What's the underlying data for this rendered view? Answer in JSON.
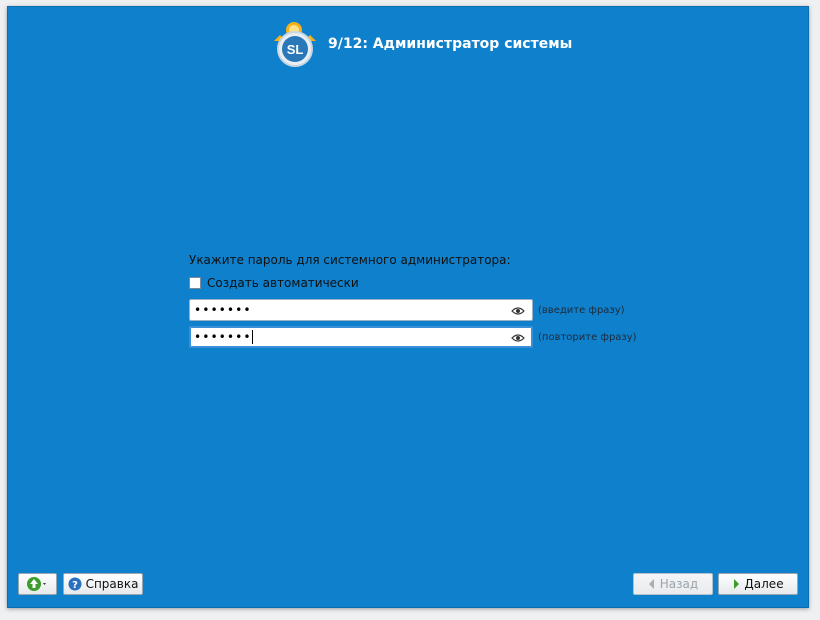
{
  "header": {
    "title": "9/12: Администратор системы",
    "logo_text": "SL"
  },
  "form": {
    "prompt": "Укажите пароль для системного администратора:",
    "auto_generate_label": "Создать автоматически",
    "auto_generate_checked": false,
    "password": {
      "value": "•••••••",
      "hint": "(введите фразу)"
    },
    "password_confirm": {
      "value": "•••••••",
      "hint": "(повторите фразу)"
    }
  },
  "footer": {
    "help_label": "Справка",
    "back_label": "Назад",
    "next_label": "Далее"
  },
  "colors": {
    "background": "#0e80cc",
    "accent_green": "#3c9c2c"
  }
}
